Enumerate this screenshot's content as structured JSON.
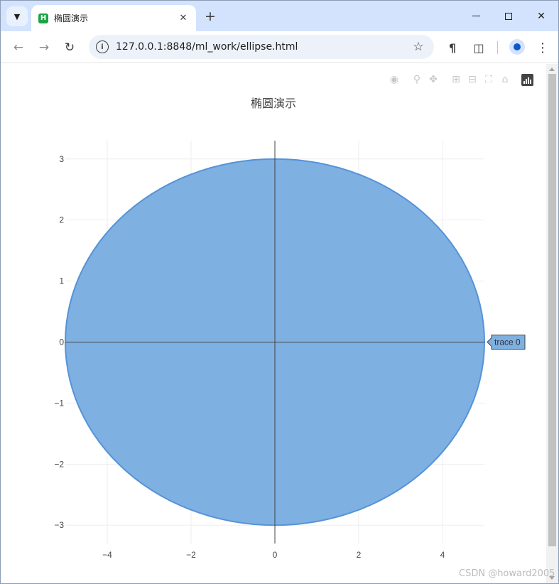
{
  "browser": {
    "tab_title": "椭圆演示",
    "tab_favicon_letter": "H",
    "url": "127.0.0.1:8848/ml_work/ellipse.html",
    "colors": {
      "tabstrip": "#d3e3fd",
      "favicon": "#1ea446"
    }
  },
  "plot": {
    "title": "椭圆演示",
    "hover_label": "trace 0",
    "fill_color": "#7eb0e2",
    "line_color": "#5593d8"
  },
  "chart_data": {
    "type": "area",
    "title": "椭圆演示",
    "xlabel": "",
    "ylabel": "",
    "xlim": [
      -5,
      5
    ],
    "ylim": [
      -3.3,
      3.3
    ],
    "x_ticks": [
      -4,
      -2,
      0,
      2,
      4
    ],
    "y_ticks": [
      -3,
      -2,
      -1,
      0,
      1,
      2,
      3
    ],
    "x_tick_labels": [
      "−4",
      "−2",
      "0",
      "2",
      "4"
    ],
    "y_tick_labels": [
      "−3",
      "−2",
      "−1",
      "0",
      "1",
      "2",
      "3"
    ],
    "grid": true,
    "series": [
      {
        "name": "trace 0",
        "shape": "ellipse",
        "a": 5,
        "b": 3,
        "center": [
          0,
          0
        ],
        "fill": "toself"
      }
    ]
  },
  "watermark": "CSDN @howard2005"
}
